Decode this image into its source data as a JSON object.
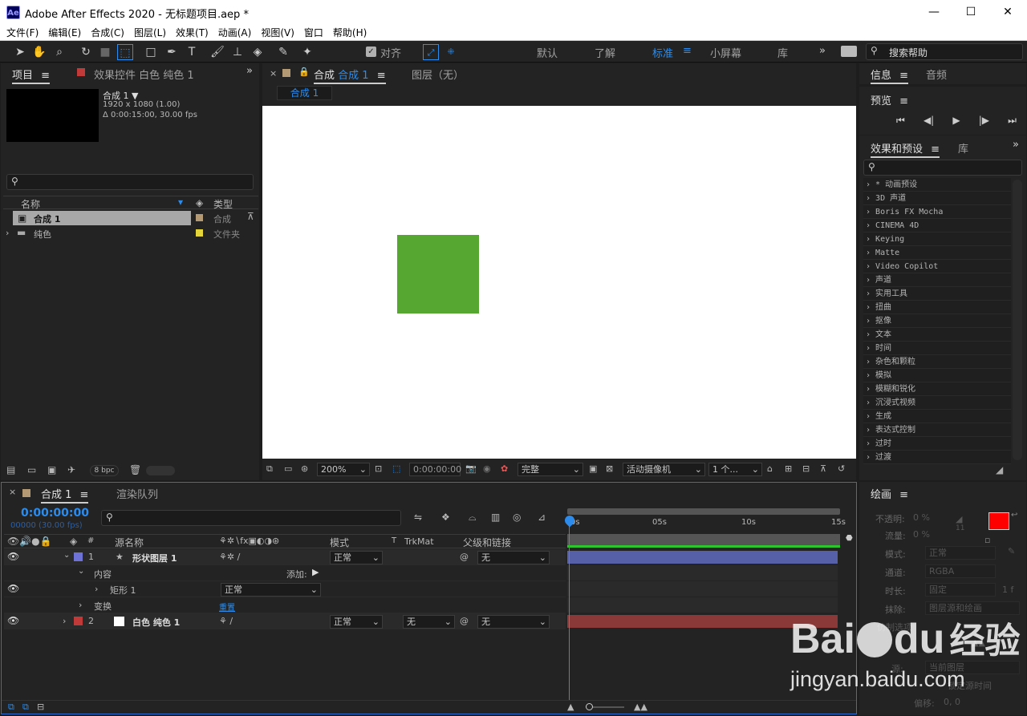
{
  "titlebar": {
    "app_title": "Adobe After Effects 2020 - 无标题项目.aep *",
    "icon": "Ae",
    "minimize": "—",
    "maximize": "☐",
    "close": "✕"
  },
  "menu": [
    "文件(F)",
    "编辑(E)",
    "合成(C)",
    "图层(L)",
    "效果(T)",
    "动画(A)",
    "视图(V)",
    "窗口",
    "帮助(H)"
  ],
  "toolbar": {
    "snap_label": "对齐",
    "workspaces": [
      "默认",
      "了解",
      "标准",
      "小屏幕",
      "库"
    ],
    "active_workspace": "标准",
    "search_placeholder": "搜索帮助"
  },
  "project": {
    "tab": "项目",
    "effects_tab": "效果控件 白色 纯色 1",
    "comp_name": "合成 1 ▼",
    "comp_size": "1920 x 1080 (1.00)",
    "comp_duration": "Δ 0:00:15:00, 30.00 fps",
    "col_name": "名称",
    "col_type": "类型",
    "items": [
      {
        "name": "合成 1",
        "type": "合成",
        "color": "#b49a74"
      },
      {
        "name": "纯色",
        "type": "文件夹",
        "color": "#e5d53a"
      }
    ],
    "bpc": "8 bpc"
  },
  "viewer": {
    "comp_tab": "合成",
    "comp_name": "合成 1",
    "layer_tab": "图层（无）",
    "breadcrumb": "合成 1",
    "zoom": "200%",
    "timecode": "0:00:00:00",
    "quality": "完整",
    "camera": "活动摄像机",
    "views": "1 个...",
    "square_color": "#56a632"
  },
  "right": {
    "info_tab": "信息",
    "audio_tab": "音频",
    "preview_tab": "预览",
    "preview_buttons": [
      "⏮",
      "◀|",
      "▶",
      "|▶",
      "⏭"
    ],
    "effects_tab": "效果和预设",
    "lib_tab": "库",
    "effects": [
      "* 动画预设",
      "3D 声道",
      "Boris FX Mocha",
      "CINEMA 4D",
      "Keying",
      "Matte",
      "Video Copilot",
      "声道",
      "实用工具",
      "扭曲",
      "抠像",
      "文本",
      "时间",
      "杂色和颗粒",
      "模拟",
      "模糊和锐化",
      "沉浸式视频",
      "生成",
      "表达式控制",
      "过时",
      "过渡"
    ]
  },
  "paragraph": {
    "tab": "绘画",
    "opacity_label": "不透明:",
    "opacity": "0 %",
    "flow_label": "流量:",
    "flow": "0 %",
    "mode_label": "模式:",
    "mode": "正常",
    "channel_label": "通道:",
    "channel": "RGBA",
    "duration_label": "时长:",
    "duration": "固定",
    "erase_label": "抹除:",
    "erase": "图层源和绘画",
    "clone_label": "仿制选项",
    "source_label": "源:",
    "source": "当前图层",
    "time_label": "锁定源时间",
    "offset_label": "偏移:",
    "offset": "0, 0",
    "brush_num": "11",
    "frames": "1 f",
    "fg_color": "#ff0000",
    "bg_color": "#ffffff"
  },
  "timeline": {
    "tab": "合成 1",
    "render_tab": "渲染队列",
    "timecode": "0:00:00:00",
    "frames": "00000 (30.00 fps)",
    "col_source": "源名称",
    "col_mode": "模式",
    "col_t": "T",
    "col_trkmat": "TrkMat",
    "col_parent": "父级和链接",
    "rows": [
      {
        "num": "1",
        "name": "形状图层 1",
        "mode": "正常",
        "parent": "无",
        "color": "#6e72d6",
        "bar": "#5560a8"
      },
      {
        "name": "内容",
        "add": "添加:"
      },
      {
        "name": "矩形 1",
        "mode": "正常"
      },
      {
        "name": "变换",
        "reset": "重置"
      },
      {
        "num": "2",
        "name": "白色 纯色 1",
        "mode": "正常",
        "trkmat": "无",
        "parent": "无",
        "color": "#c13a3a",
        "bar": "#8a3838"
      }
    ],
    "ruler": [
      "0s",
      "05s",
      "10s",
      "15s"
    ]
  },
  "watermark": {
    "text1": "Bai",
    "text2": "du",
    "text3": "经验",
    "url": "jingyan.baidu.com"
  }
}
